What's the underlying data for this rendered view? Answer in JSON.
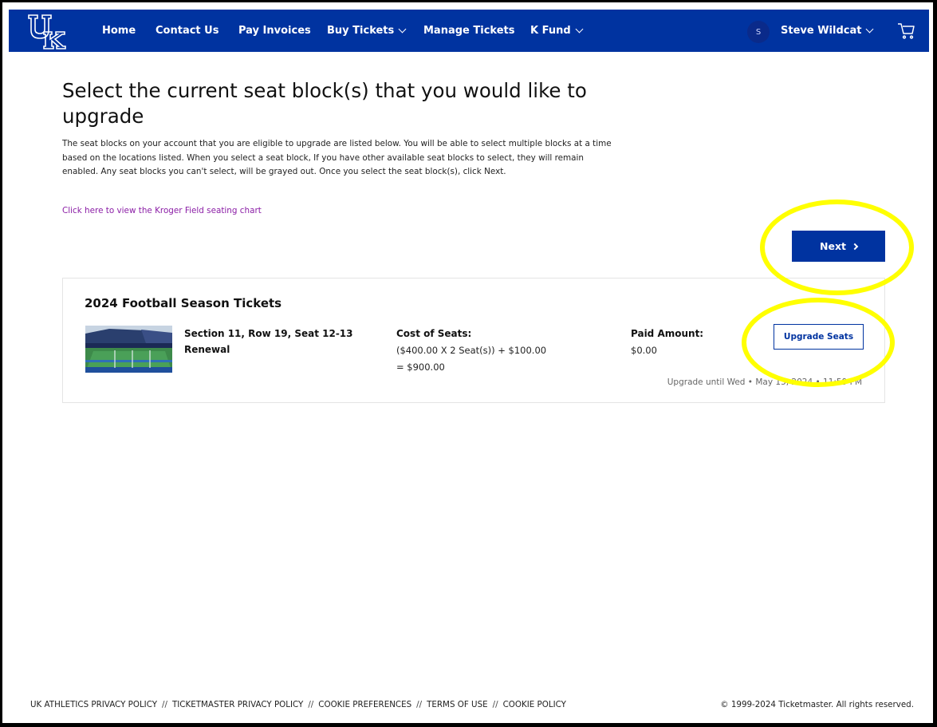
{
  "nav": {
    "logo_icon": "uk-logo-icon",
    "links": [
      {
        "label": "Home"
      },
      {
        "label": "Contact Us"
      },
      {
        "label": "Pay Invoices"
      },
      {
        "label": "Buy Tickets"
      },
      {
        "label": "Manage Tickets"
      },
      {
        "label": "K Fund"
      }
    ],
    "avatar_initial": "S",
    "user_name": "Steve Wildcat",
    "cart_icon": "cart-icon"
  },
  "main": {
    "title": "Select the current seat block(s) that you would like to upgrade",
    "description": "The seat blocks on your account that you are eligible to upgrade are listed below. You will be able to select multiple blocks at a time based on the locations listed. When you select a seat block, If you have other available seat blocks to select, they will remain enabled. Any seat blocks you can't select, will be grayed out. Once you select the seat block(s), click Next.",
    "seating_chart_link": "Click here to view the Kroger Field seating chart",
    "next_label": "Next"
  },
  "card": {
    "title": "2024 Football Season Tickets",
    "seat_info": "Section 11, Row 19, Seat 12-13",
    "seat_type": "Renewal",
    "cost_label": "Cost of Seats:",
    "cost_line1": "($400.00 X 2 Seat(s)) + $100.00",
    "cost_line2": "= $900.00",
    "paid_label": "Paid Amount:",
    "paid_value": "$0.00",
    "upgrade_label": "Upgrade Seats",
    "upgrade_until": "Upgrade until Wed • May 15, 2024 • 11:59 PM"
  },
  "footer": {
    "links": [
      "UK ATHLETICS PRIVACY POLICY",
      "TICKETMASTER PRIVACY POLICY",
      "COOKIE PREFERENCES",
      "TERMS OF USE",
      "COOKIE POLICY"
    ],
    "separator": "//",
    "copyright": "© 1999-2024 Ticketmaster. All rights reserved."
  },
  "colors": {
    "brand_blue": "#0033a0",
    "link_purple": "#8b1ea6",
    "highlight_yellow": "#ffff00"
  }
}
